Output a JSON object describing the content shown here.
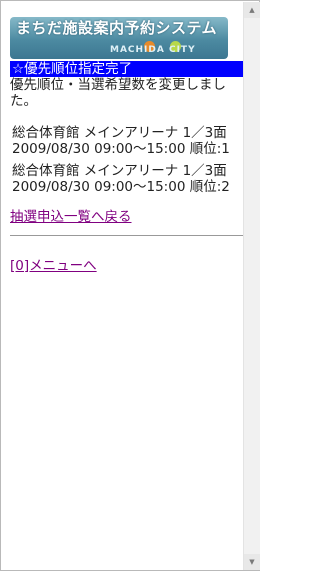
{
  "header": {
    "title": "まちだ施設案内予約システム",
    "subtitle": "MACHIDA CITY"
  },
  "page_title": "☆優先順位指定完了",
  "message": "優先順位・当選希望数を変更しました。",
  "entries": [
    {
      "text": "総合体育館 メインアリーナ 1／3面 2009/08/30 09:00～15:00 順位:1"
    },
    {
      "text": "総合体育館 メインアリーナ 1／3面 2009/08/30 09:00～15:00 順位:2"
    }
  ],
  "links": {
    "back": "抽選申込一覧へ戻る",
    "menu": "[0]メニューへ"
  },
  "colors": {
    "title_bar": "#0000ff",
    "link": "#800080"
  }
}
